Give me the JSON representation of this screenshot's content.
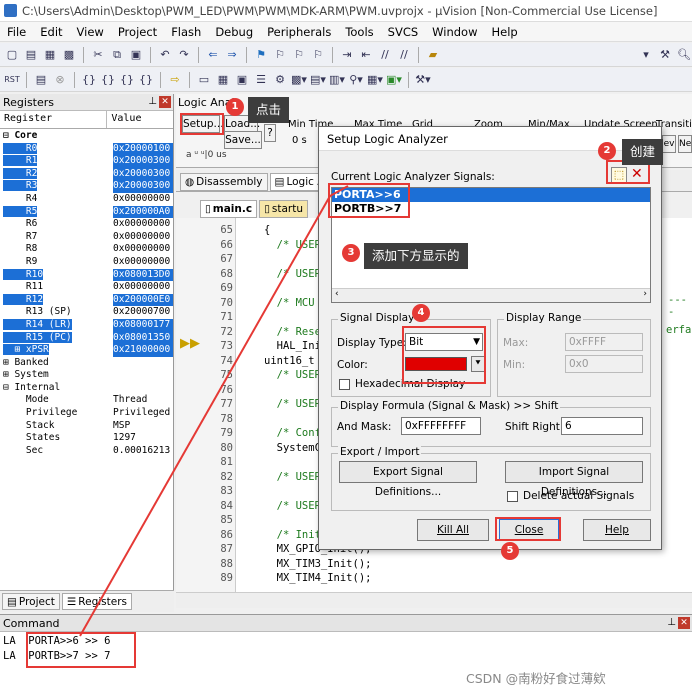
{
  "window": {
    "title": "C:\\Users\\Admin\\Desktop\\PWM_LED\\PWM\\PWM\\MDK-ARM\\PWM.uvprojx - µVision  [Non-Commercial Use License]"
  },
  "menu": [
    "File",
    "Edit",
    "View",
    "Project",
    "Flash",
    "Debug",
    "Peripherals",
    "Tools",
    "SVCS",
    "Window",
    "Help"
  ],
  "registers": {
    "title": "Registers",
    "col_register": "Register",
    "col_value": "Value",
    "rows": [
      {
        "name": "⊟ Core",
        "value": "",
        "sel": false,
        "bold": true
      },
      {
        "name": "    R0",
        "value": "0x20000100",
        "sel": true
      },
      {
        "name": "    R1",
        "value": "0x20000300",
        "sel": true
      },
      {
        "name": "    R2",
        "value": "0x20000300",
        "sel": true
      },
      {
        "name": "    R3",
        "value": "0x20000300",
        "sel": true
      },
      {
        "name": "    R4",
        "value": "0x00000000",
        "sel": false
      },
      {
        "name": "    R5",
        "value": "0x200000A0",
        "sel": true
      },
      {
        "name": "    R6",
        "value": "0x00000000",
        "sel": false
      },
      {
        "name": "    R7",
        "value": "0x00000000",
        "sel": false
      },
      {
        "name": "    R8",
        "value": "0x00000000",
        "sel": false
      },
      {
        "name": "    R9",
        "value": "0x00000000",
        "sel": false
      },
      {
        "name": "    R10",
        "value": "0x080013D0",
        "sel": true
      },
      {
        "name": "    R11",
        "value": "0x00000000",
        "sel": false
      },
      {
        "name": "    R12",
        "value": "0x200000E0",
        "sel": true
      },
      {
        "name": "    R13 (SP)",
        "value": "0x20000700",
        "sel": false
      },
      {
        "name": "    R14 (LR)",
        "value": "0x08000177",
        "sel": true
      },
      {
        "name": "    R15 (PC)",
        "value": "0x08001350",
        "sel": true
      },
      {
        "name": "  ⊞ xPSR",
        "value": "0x21000000",
        "sel": true
      },
      {
        "name": "⊞ Banked",
        "value": "",
        "sel": false
      },
      {
        "name": "⊞ System",
        "value": "",
        "sel": false
      },
      {
        "name": "⊟ Internal",
        "value": "",
        "sel": false
      },
      {
        "name": "    Mode",
        "value": "Thread",
        "sel": false
      },
      {
        "name": "    Privilege",
        "value": "Privileged",
        "sel": false
      },
      {
        "name": "    Stack",
        "value": "MSP",
        "sel": false
      },
      {
        "name": "    States",
        "value": "1297",
        "sel": false
      },
      {
        "name": "    Sec",
        "value": "0.00016213",
        "sel": false
      }
    ],
    "tab_project": "Project",
    "tab_registers": "Registers"
  },
  "logic": {
    "title": "Logic Anal",
    "setup": "Setup...",
    "load": "Load...",
    "save": "Save...",
    "help": "?",
    "min_time": "Min Time",
    "max_time": "Max Time",
    "grid": "Grid",
    "zoom": "Zoom",
    "minmax": "Min/Max",
    "update_screen": "Update Screen",
    "transition": "Transitio",
    "min_time_val": "0 s",
    "ruler": "0 us",
    "prev": "ev",
    "next": "Ne"
  },
  "editor": {
    "tab_disassembly": "Disassembly",
    "tab_logic": "Logic Ar",
    "file_main": "main.c",
    "file_startup": "startu",
    "lines": [
      {
        "n": "65",
        "t": "{",
        "c": false
      },
      {
        "n": "66",
        "t": "  /* USER",
        "c": true
      },
      {
        "n": "67",
        "t": "",
        "c": false
      },
      {
        "n": "68",
        "t": "  /* USER",
        "c": true
      },
      {
        "n": "69",
        "t": "",
        "c": false
      },
      {
        "n": "70",
        "t": "  /* MCU",
        "c": true
      },
      {
        "n": "71",
        "t": "",
        "c": false
      },
      {
        "n": "72",
        "t": "  /* Rese",
        "c": true
      },
      {
        "n": "73",
        "t": "  HAL_Init",
        "c": false
      },
      {
        "n": "74",
        "t": "uint16_t c",
        "c": false
      },
      {
        "n": "75",
        "t": "  /* USER",
        "c": true
      },
      {
        "n": "76",
        "t": "",
        "c": false
      },
      {
        "n": "77",
        "t": "  /* USER",
        "c": true
      },
      {
        "n": "78",
        "t": "",
        "c": false
      },
      {
        "n": "79",
        "t": "  /* Conf",
        "c": true
      },
      {
        "n": "80",
        "t": "  SystemCl",
        "c": false
      },
      {
        "n": "81",
        "t": "",
        "c": false
      },
      {
        "n": "82",
        "t": "  /* USER",
        "c": true
      },
      {
        "n": "83",
        "t": "",
        "c": false
      },
      {
        "n": "84",
        "t": "  /* USER",
        "c": true
      },
      {
        "n": "85",
        "t": "",
        "c": false
      },
      {
        "n": "86",
        "t": "  /* Init",
        "c": true
      },
      {
        "n": "87",
        "t": "  MX_GPIO_Init();",
        "c": false
      },
      {
        "n": "88",
        "t": "  MX_TIM3_Init();",
        "c": false
      },
      {
        "n": "89",
        "t": "  MX_TIM4_Init();",
        "c": false
      }
    ],
    "right_frag_1": "erfac",
    "right_frag_2": "----"
  },
  "dialog": {
    "title": "Setup Logic Analyzer",
    "signals_label": "Current Logic Analyzer Signals:",
    "signals": [
      "PORTA>>6",
      "PORTB>>7"
    ],
    "signal_display": "Signal Display",
    "display_type_label": "Display Type:",
    "display_type": "Bit",
    "color_label": "Color:",
    "hex_display": "Hexadecimal Display",
    "display_range": "Display Range",
    "max_label": "Max:",
    "max_val": "0xFFFF",
    "min_label": "Min:",
    "min_val": "0x0",
    "formula_group": "Display Formula (Signal & Mask) >> Shift",
    "and_mask_label": "And Mask:",
    "and_mask_val": "0xFFFFFFFF",
    "shift_right_label": "Shift Right:",
    "shift_right_val": "6",
    "export_import": "Export / Import",
    "export_btn": "Export Signal Definitions...",
    "import_btn": "Import Signal Definitions...",
    "delete_actual": "Delete actual Signals",
    "kill_all": "Kill All",
    "close": "Close",
    "help": "Help",
    "signal_color": "#e00000"
  },
  "command": {
    "title": "Command",
    "lines": [
      "LA  PORTA>>6 >> 6",
      "LA  PORTB>>7 >> 7"
    ]
  },
  "annotations": [
    {
      "num": "1",
      "text": "点击"
    },
    {
      "num": "2",
      "text": "创建"
    },
    {
      "num": "3",
      "text": "添加下方显示的"
    },
    {
      "num": "4",
      "text": ""
    },
    {
      "num": "5",
      "text": ""
    }
  ],
  "watermark": "CSDN @南粉好食过薄欸"
}
